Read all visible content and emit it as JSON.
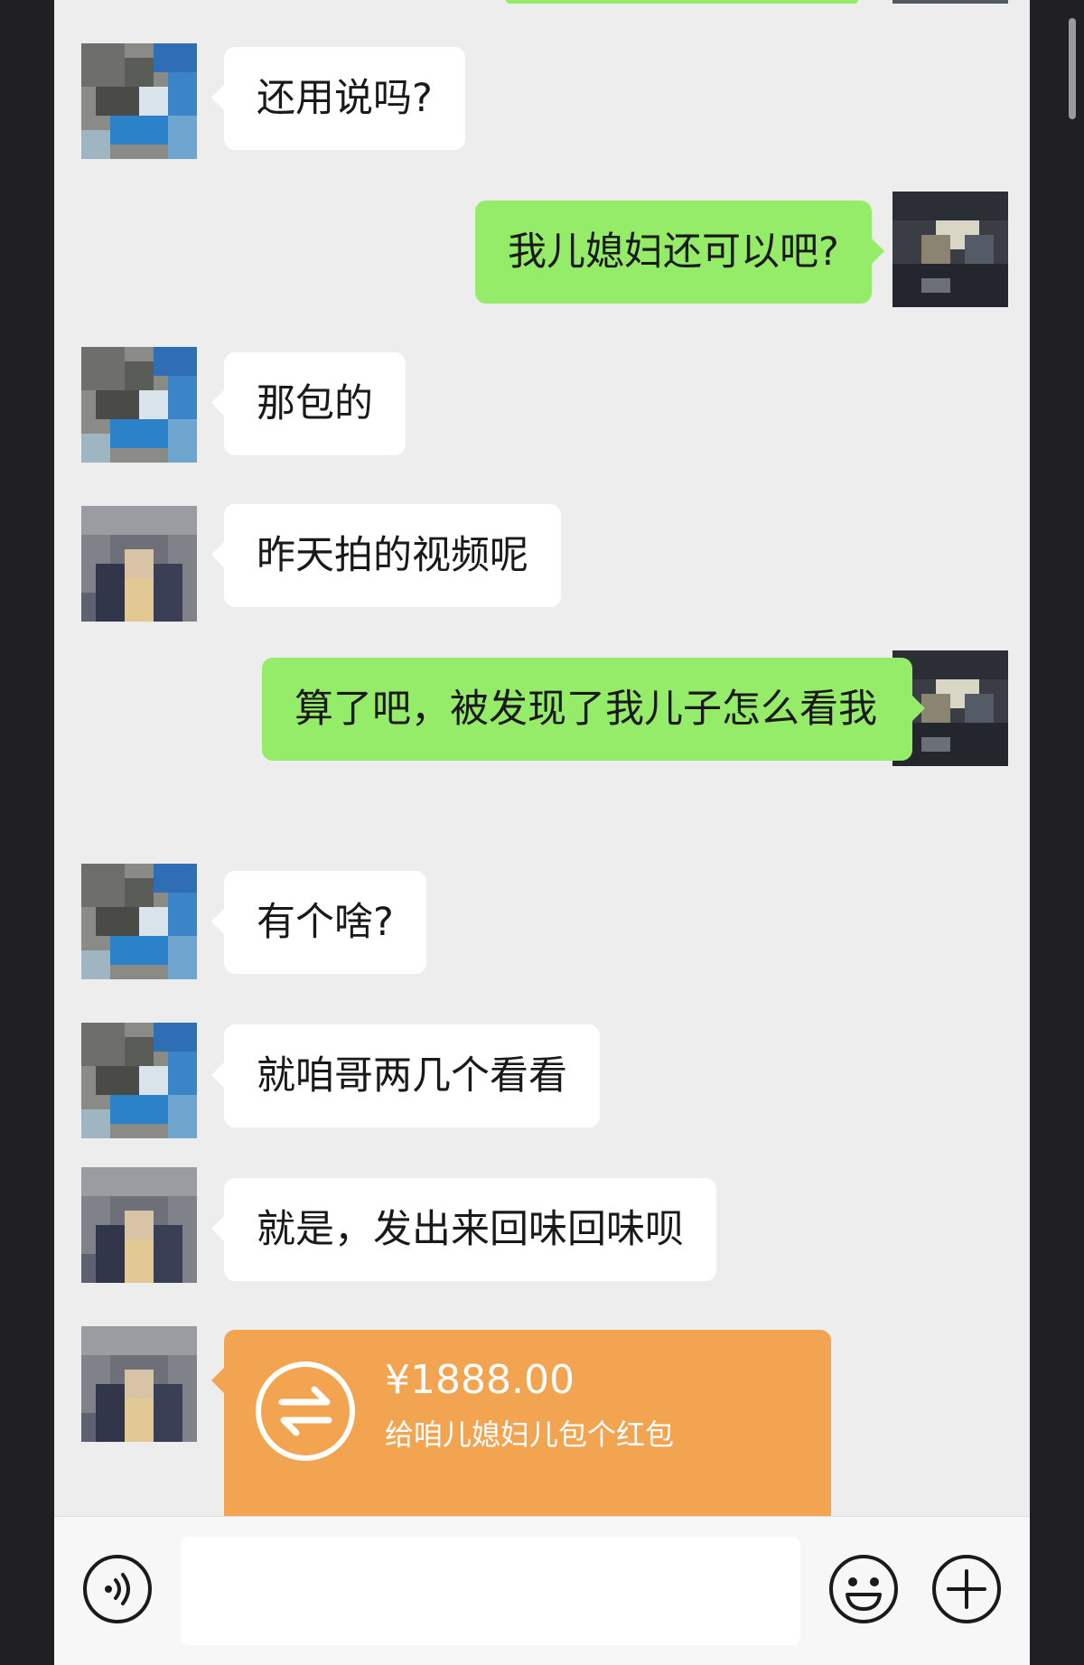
{
  "messages": [
    {
      "side": "in",
      "text": "还用说吗?"
    },
    {
      "side": "out",
      "text": "我儿媳妇还可以吧?"
    },
    {
      "side": "in",
      "text": "那包的"
    },
    {
      "side": "in",
      "text": "昨天拍的视频呢"
    },
    {
      "side": "out",
      "text": "算了吧，被发现了我儿子怎么看我"
    },
    {
      "side": "in",
      "text": "有个啥?"
    },
    {
      "side": "in",
      "text": "就咱哥两几个看看"
    },
    {
      "side": "in",
      "text": "就是，发出来回味回味呗"
    }
  ],
  "transfer": {
    "amount": "¥1888.00",
    "note": "给咱儿媳妇儿包个红包",
    "icon": "transfer-arrows-icon",
    "color": "#f2a451"
  },
  "input_bar": {
    "voice_icon": "voice-icon",
    "emoji_icon": "emoji-icon",
    "plus_icon": "plus-icon",
    "value": ""
  },
  "colors": {
    "background": "#ededed",
    "outgoing_bubble": "#95ec69",
    "incoming_bubble": "#ffffff"
  }
}
